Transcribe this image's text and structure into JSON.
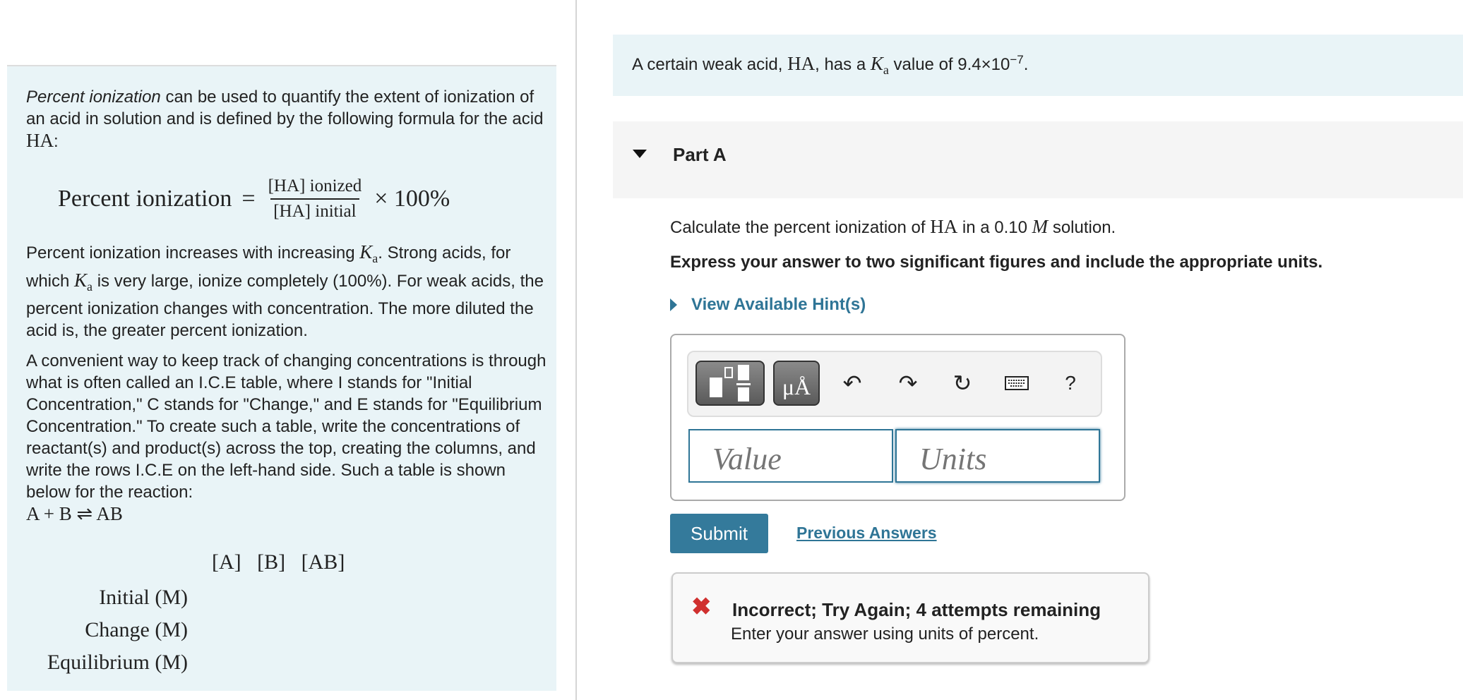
{
  "intro": {
    "p1_em": "Percent ionization",
    "p1_rest": " can be used to quantify the extent of ionization of an acid in solution and is defined by the following formula for the acid ",
    "p1_acid": "HA",
    "p1_end": ":",
    "formula": {
      "lhs": "Percent ionization",
      "eq": "=",
      "numerator": "[HA] ionized",
      "denominator": "[HA] initial",
      "times": "× 100%"
    },
    "p2_a": "Percent ionization increases with increasing ",
    "ka_K": "K",
    "ka_a": "a",
    "p2_b": ". Strong acids, for which ",
    "p2_c": " is very large, ionize completely (100%). For weak acids, the percent ionization changes with concentration. The more diluted the acid is, the greater percent ionization.",
    "p3": "A convenient way to keep track of changing concentrations is through what is often called an I.C.E table, where I stands for \"Initial Concentration,\" C stands for \"Change,\" and E stands for \"Equilibrium Concentration.\" To create such a table, write the concentrations of reactant(s) and product(s) across the top, creating the columns, and write the rows I.C.E on the left-hand side. Such a table is shown below for the reaction:",
    "reaction": "A + B ⇌ AB",
    "ice_table": {
      "columns": [
        "[A]",
        "[B]",
        "[AB]"
      ],
      "rows": [
        "Initial (M)",
        "Change (M)",
        "Equilibrium (M)"
      ]
    }
  },
  "problem": {
    "statement_a": "A certain weak acid, ",
    "acid": "HA",
    "statement_b": ", has a ",
    "statement_c": " value of 9.4×10",
    "exponent": "−7",
    "statement_end": "."
  },
  "part": {
    "title": "Part A",
    "question_a": "Calculate the percent ionization of ",
    "question_acid": "HA",
    "question_b": " in a 0.10 ",
    "question_unit": "M",
    "question_c": " solution.",
    "instruction": "Express your answer to two significant figures and include the appropriate units.",
    "hint_link": "View Available Hint(s)"
  },
  "answer": {
    "toolbar": {
      "units_button": "μÅ",
      "help": "?",
      "icons": [
        "templates-icon",
        "units-icon",
        "undo-icon",
        "redo-icon",
        "reset-icon",
        "keyboard-icon",
        "help-icon"
      ]
    },
    "value_placeholder": "Value",
    "units_placeholder": "Units",
    "submit": "Submit",
    "previous_answers": "Previous Answers"
  },
  "feedback": {
    "title": "Incorrect; Try Again; 4 attempts remaining",
    "message": "Enter your answer using units of percent.",
    "error_color": "#d0302f"
  },
  "colors": {
    "accent": "#347a9b",
    "panel": "#e9f4f7"
  }
}
